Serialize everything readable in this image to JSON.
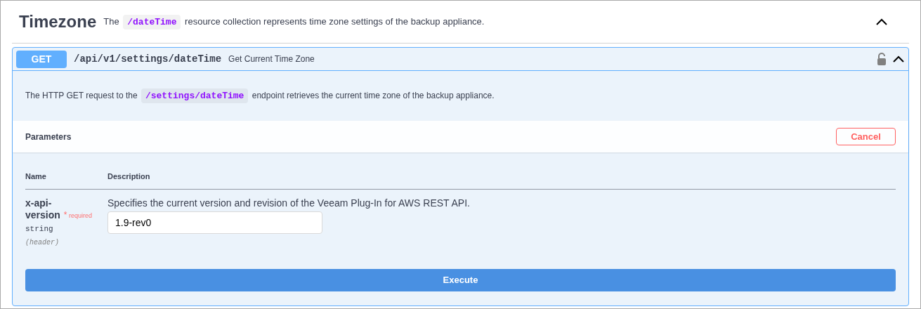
{
  "section": {
    "title": "Timezone",
    "expanded": true,
    "description": [
      {
        "kind": "text",
        "text": "The "
      },
      {
        "kind": "code",
        "text": "/dateTime"
      },
      {
        "kind": "text",
        "text": " resource collection represents time zone settings of the backup appliance."
      }
    ]
  },
  "operation": {
    "method": "GET",
    "path": "/api/v1/settings/dateTime",
    "summary": "Get Current Time Zone",
    "locked": false,
    "expanded": true,
    "description": [
      {
        "kind": "text",
        "text": "The HTTP GET request to the "
      },
      {
        "kind": "code",
        "text": "/settings/dateTime"
      },
      {
        "kind": "text",
        "text": " endpoint retrieves the current time zone of the backup appliance."
      }
    ],
    "parameters_title": "Parameters",
    "cancel_button": "Cancel",
    "columns": [
      "Name",
      "Description"
    ],
    "parameters": [
      {
        "name_lines": [
          "x-api-",
          "version"
        ],
        "required_mark": "*",
        "required_label": "required",
        "type": "string",
        "location": "(header)",
        "description": "Specifies the current version and revision of the Veeam Plug-In for AWS REST API.",
        "value": "1.9-rev0"
      }
    ],
    "execute_button": "Execute"
  }
}
